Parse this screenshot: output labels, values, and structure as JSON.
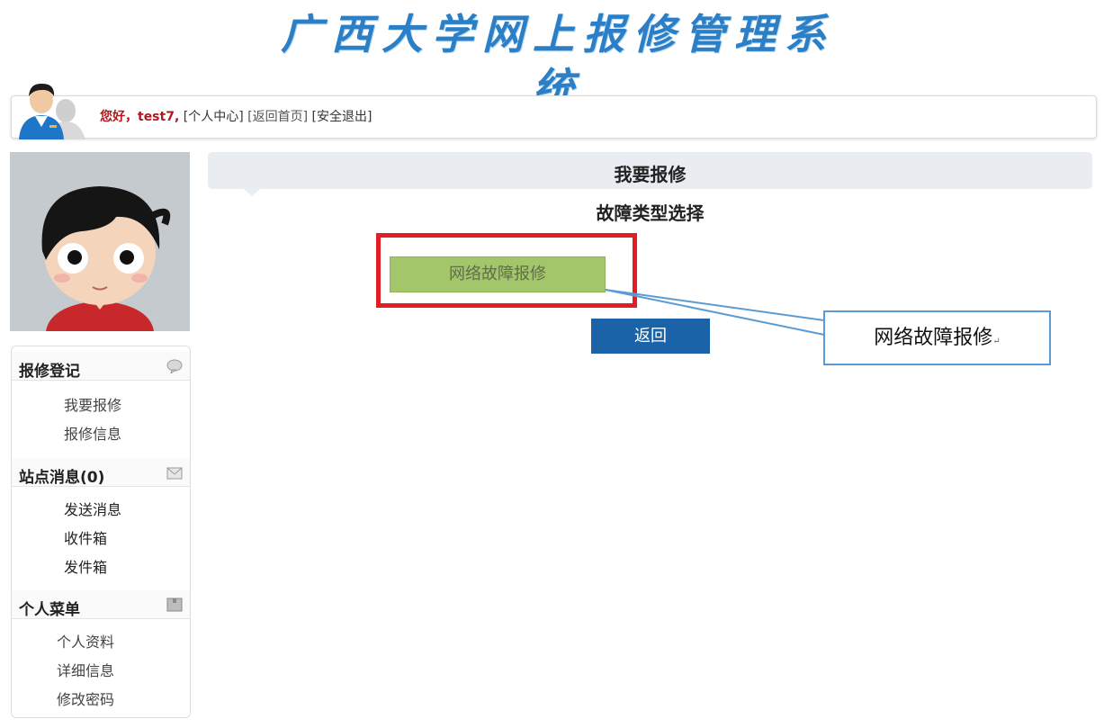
{
  "site": {
    "title": "广西大学网上报修管理系统"
  },
  "user_bar": {
    "greeting": "您好，test7,",
    "links": [
      "[个人中心]",
      "[返回首页]",
      "[安全退出]"
    ]
  },
  "sidebar": {
    "sections": [
      {
        "title": "报修登记",
        "icon": "speech-bubble-icon",
        "items": [
          "我要报修",
          "报修信息"
        ]
      },
      {
        "title": "站点消息(0)",
        "icon": "envelope-icon",
        "items": [
          "发送消息",
          "收件箱",
          "发件箱"
        ]
      },
      {
        "title": "个人菜单",
        "icon": "box-icon",
        "items": [
          "个人资料",
          "详细信息",
          "修改密码"
        ]
      }
    ]
  },
  "main": {
    "header_title": "我要报修",
    "subtitle": "故障类型选择",
    "option_button": "网络故障报修",
    "back_button": "返回"
  },
  "callout": {
    "text": "网络故障报修",
    "return_mark": "↵"
  },
  "colors": {
    "title_blue": "#2a7fc6",
    "greeting_red": "#b0191c",
    "highlight_red": "#e21d24",
    "option_green": "#a3c66a",
    "back_blue": "#1a63a8",
    "callout_border": "#5b9bd5"
  }
}
